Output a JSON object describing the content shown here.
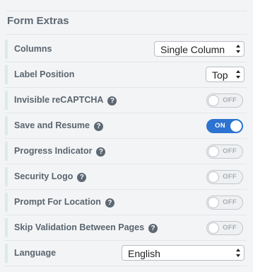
{
  "section": {
    "title": "Form Extras"
  },
  "rows": {
    "columns": {
      "label": "Columns",
      "value": "Single Column"
    },
    "label_position": {
      "label": "Label Position",
      "value": "Top"
    },
    "recaptcha": {
      "label": "Invisible reCAPTCHA",
      "help": "?",
      "state": "OFF"
    },
    "save_resume": {
      "label": "Save and Resume",
      "help": "?",
      "state": "ON"
    },
    "progress": {
      "label": "Progress Indicator",
      "help": "?",
      "state": "OFF"
    },
    "security_logo": {
      "label": "Security Logo",
      "help": "?",
      "state": "OFF"
    },
    "prompt_location": {
      "label": "Prompt For Location",
      "help": "?",
      "state": "OFF"
    },
    "skip_validation": {
      "label": "Skip Validation Between Pages",
      "help": "?",
      "state": "OFF"
    },
    "language": {
      "label": "Language",
      "value": "English"
    }
  },
  "colors": {
    "accent": "#2c73d2",
    "row_marker": "#d8ece6"
  }
}
